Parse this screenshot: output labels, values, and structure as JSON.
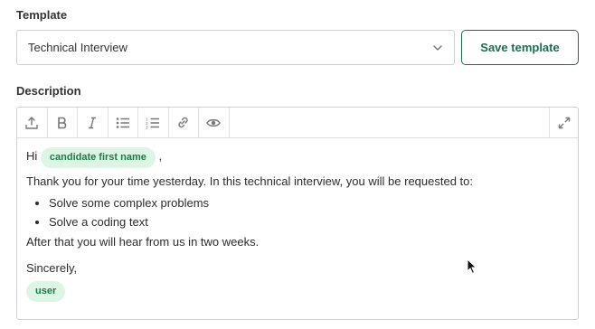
{
  "template": {
    "label": "Template",
    "selected": "Technical Interview",
    "save_label": "Save template"
  },
  "description": {
    "label": "Description",
    "toolbar": [
      "upload-icon",
      "bold-icon",
      "italic-icon",
      "bulleted-list-icon",
      "numbered-list-icon",
      "link-icon",
      "preview-eye-icon",
      "fullscreen-icon"
    ],
    "greeting": "Hi",
    "candidate_chip": "candidate first name",
    "comma": ",",
    "intro": "Thank you for your time yesterday. In this technical interview, you will be requested to:",
    "bullets": [
      "Solve some complex problems",
      "Solve a coding text"
    ],
    "after": "After that you will hear from us in two weeks.",
    "signoff": "Sincerely,",
    "user_chip": "user"
  },
  "colors": {
    "accent": "#1e6b52",
    "chip_bg": "#dcf5e4",
    "chip_text": "#1f7a4a"
  }
}
